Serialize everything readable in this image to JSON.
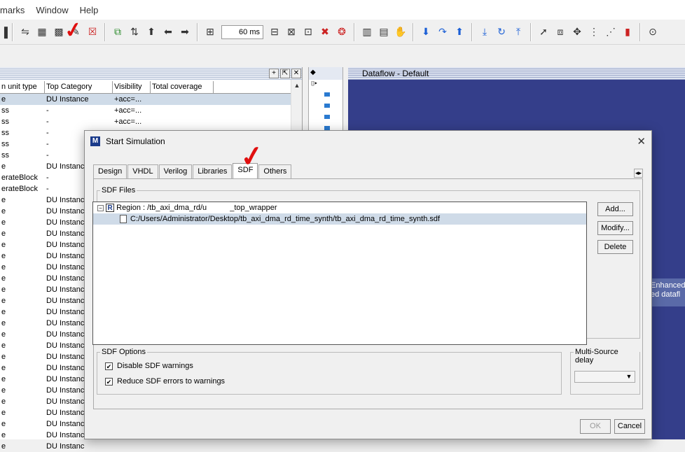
{
  "menubar": {
    "items": [
      "marks",
      "Window",
      "Help"
    ]
  },
  "toolbar": {
    "time_value": "60 ms"
  },
  "icons": [
    "run-icon",
    "calc-icon",
    "step-icon",
    "edit-icon",
    "stop-icon",
    "copy-icon",
    "sort-icon",
    "up-arrow-icon",
    "left-arrow-icon",
    "right-arrow-icon",
    "time-icon",
    "wave-icon",
    "break-icon",
    "bookmark-icon",
    "delete-icon",
    "chart-icon",
    "marker-icon",
    "hand-icon",
    "down-arrow-icon",
    "redo-icon",
    "up-icon",
    "step-over-icon",
    "step-into-icon",
    "step-out-icon",
    "pointer-icon",
    "zoom-icon",
    "move-icon",
    "cursor-icon",
    "list-icon",
    "signal-icon",
    "clock-icon"
  ],
  "structure": {
    "columns": [
      "n unit type",
      "Top Category",
      "Visibility",
      "Total coverage"
    ],
    "rows": [
      {
        "type": "e",
        "cat": "DU Instance",
        "vis": "+acc=..."
      },
      {
        "type": "ss",
        "cat": "-",
        "vis": "+acc=..."
      },
      {
        "type": "ss",
        "cat": "-",
        "vis": "+acc=..."
      },
      {
        "type": "ss",
        "cat": "-",
        "vis": ""
      },
      {
        "type": "ss",
        "cat": "-",
        "vis": ""
      },
      {
        "type": "ss",
        "cat": "-",
        "vis": ""
      },
      {
        "type": "e",
        "cat": "DU Instanc",
        "vis": ""
      },
      {
        "type": "erateBlock",
        "cat": "-",
        "vis": ""
      },
      {
        "type": "erateBlock",
        "cat": "-",
        "vis": ""
      },
      {
        "type": "e",
        "cat": "DU Instanc",
        "vis": ""
      },
      {
        "type": "e",
        "cat": "DU Instanc",
        "vis": ""
      },
      {
        "type": "e",
        "cat": "DU Instanc",
        "vis": ""
      },
      {
        "type": "e",
        "cat": "DU Instanc",
        "vis": ""
      },
      {
        "type": "e",
        "cat": "DU Instanc",
        "vis": ""
      },
      {
        "type": "e",
        "cat": "DU Instanc",
        "vis": ""
      },
      {
        "type": "e",
        "cat": "DU Instanc",
        "vis": ""
      },
      {
        "type": "e",
        "cat": "DU Instanc",
        "vis": ""
      },
      {
        "type": "e",
        "cat": "DU Instanc",
        "vis": ""
      },
      {
        "type": "e",
        "cat": "DU Instanc",
        "vis": ""
      },
      {
        "type": "e",
        "cat": "DU Instanc",
        "vis": ""
      },
      {
        "type": "e",
        "cat": "DU Instanc",
        "vis": ""
      },
      {
        "type": "e",
        "cat": "DU Instanc",
        "vis": ""
      },
      {
        "type": "e",
        "cat": "DU Instanc",
        "vis": ""
      },
      {
        "type": "e",
        "cat": "DU Instanc",
        "vis": ""
      },
      {
        "type": "e",
        "cat": "DU Instanc",
        "vis": ""
      },
      {
        "type": "e",
        "cat": "DU Instanc",
        "vis": ""
      },
      {
        "type": "e",
        "cat": "DU Instanc",
        "vis": ""
      },
      {
        "type": "e",
        "cat": "DU Instanc",
        "vis": ""
      },
      {
        "type": "e",
        "cat": "DU Instanc",
        "vis": ""
      },
      {
        "type": "e",
        "cat": "DU Instanc",
        "vis": ""
      },
      {
        "type": "e",
        "cat": "DU Instanc",
        "vis": ""
      },
      {
        "type": "e",
        "cat": "DU Instanc",
        "vis": ""
      }
    ]
  },
  "dataflow": {
    "title": "Dataflow - Default",
    "overlay_line1": "Enhanced",
    "overlay_line2": "ed datafl"
  },
  "dialog": {
    "title": "Start Simulation",
    "tabs": [
      "Design",
      "VHDL",
      "Verilog",
      "Libraries",
      "SDF",
      "Others"
    ],
    "active_tab": "SDF",
    "sdf_files_label": "SDF Files",
    "region_label": "Region : /tb_axi_dma_rd/u",
    "region_suffix": "_top_wrapper",
    "sdf_file_path": "C:/Users/Administrator/Desktop/tb_axi_dma_rd_time_synth/tb_axi_dma_rd_time_synth.sdf",
    "add_label": "Add...",
    "modify_label": "Modify...",
    "delete_label": "Delete",
    "sdf_options_label": "SDF Options",
    "opt_disable_warnings": "Disable SDF warnings",
    "opt_reduce_errors": "Reduce SDF errors to warnings",
    "multi_source_label": "Multi-Source delay",
    "ok_label": "OK",
    "cancel_label": "Cancel"
  },
  "colors": {
    "annotation_red": "#e01010",
    "selection": "#cfdbe8",
    "dataflow_bg": "#343e8a"
  }
}
